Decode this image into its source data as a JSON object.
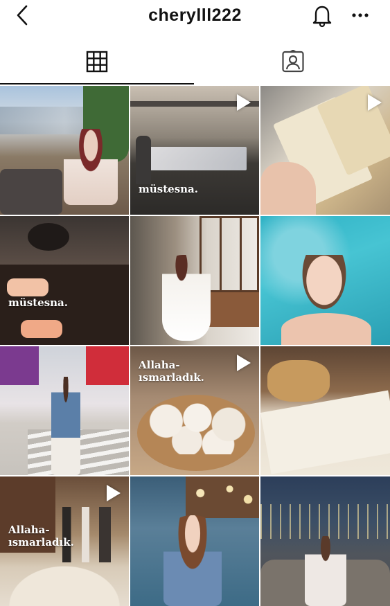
{
  "header": {
    "username": "cherylll222"
  },
  "tiles": [
    {
      "overlay": "",
      "video": false
    },
    {
      "overlay": "müstesna.",
      "video": true
    },
    {
      "overlay": "",
      "video": true
    },
    {
      "overlay": "müstesna.",
      "video": false
    },
    {
      "overlay": "",
      "video": false
    },
    {
      "overlay": "",
      "video": false
    },
    {
      "overlay": "",
      "video": false
    },
    {
      "overlay": "Allaha-ısmarladık.",
      "video": true
    },
    {
      "overlay": "",
      "video": false
    },
    {
      "overlay": "Allaha-ısmarladık.",
      "video": true
    },
    {
      "overlay": "",
      "video": false
    },
    {
      "overlay": "",
      "video": false
    }
  ],
  "colors": {
    "tab_active": "#111111",
    "divider": "#ffffff"
  }
}
